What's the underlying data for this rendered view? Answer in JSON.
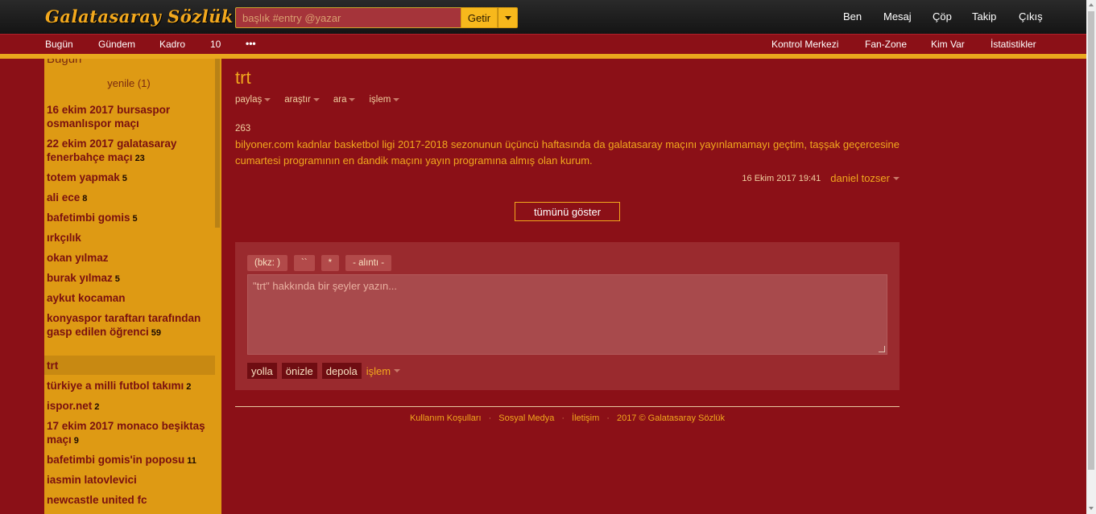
{
  "header": {
    "logo": "Galatasaray Sözlük",
    "search_placeholder": "başlık #entry @yazar",
    "search_button": "Getir",
    "user_nav": [
      "Ben",
      "Mesaj",
      "Çöp",
      "Takip",
      "Çıkış"
    ]
  },
  "subnav": {
    "left": [
      "Bugün",
      "Gündem",
      "Kadro",
      "10",
      "•••"
    ],
    "right": [
      "Kontrol Merkezi",
      "Fan-Zone",
      "Kim Var",
      "İstatistikler"
    ]
  },
  "sidebar": {
    "title": "Bugün",
    "refresh": "yenile (1)",
    "topics": [
      {
        "title": "16 ekim 2017 bursaspor osmanlıspor maçı",
        "count": ""
      },
      {
        "title": "22 ekim 2017 galatasaray fenerbahçe maçı",
        "count": "23"
      },
      {
        "title": "totem yapmak",
        "count": "5"
      },
      {
        "title": "ali ece",
        "count": "8"
      },
      {
        "title": "bafetimbi gomis",
        "count": "5"
      },
      {
        "title": "ırkçılık",
        "count": ""
      },
      {
        "title": "okan yılmaz",
        "count": ""
      },
      {
        "title": "burak yılmaz",
        "count": "5"
      },
      {
        "title": "aykut kocaman",
        "count": ""
      },
      {
        "title": "konyaspor taraftarı tarafından gasp edilen öğrenci",
        "count": "59"
      },
      {
        "title": "trt",
        "count": ""
      },
      {
        "title": "türkiye a milli futbol takımı",
        "count": "2"
      },
      {
        "title": "ispor.net",
        "count": "2"
      },
      {
        "title": "17 ekim 2017 monaco beşiktaş maçı",
        "count": "9"
      },
      {
        "title": "bafetimbi gomis'in poposu",
        "count": "11"
      },
      {
        "title": "iasmin latovlevici",
        "count": ""
      },
      {
        "title": "newcastle united fc",
        "count": ""
      }
    ]
  },
  "main": {
    "title": "trt",
    "actions": [
      "paylaş",
      "araştır",
      "ara",
      "işlem"
    ],
    "entry": {
      "number": "263",
      "body": "bilyoner.com kadnlar basketbol ligi 2017-2018 sezonunun üçüncü haftasında da galatasaray maçını yayınlamamayı geçtim, taşşak geçercesine cumartesi programının en dandik maçını yayın programına almış olan kurum.",
      "date": "16 Ekim 2017 19:41",
      "author": "daniel tozser"
    },
    "show_all": "tümünü göster"
  },
  "editor": {
    "format_buttons": [
      "(bkz: )",
      "``",
      "*",
      "- alıntı -"
    ],
    "placeholder": "\"trt\" hakkında bir şeyler yazın...",
    "buttons": [
      "yolla",
      "önizle",
      "depola"
    ],
    "actions": "işlem"
  },
  "footer": {
    "links": [
      "Kullanım Koşulları",
      "Sosyal Medya",
      "İletişim",
      "2017 © Galatasaray Sözlük"
    ]
  }
}
